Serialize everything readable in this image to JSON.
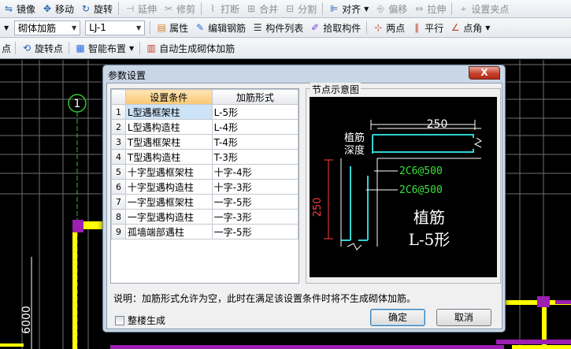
{
  "toolbar1": {
    "items": [
      {
        "icon": "mirror-icon",
        "label": "镜像",
        "enabled": true
      },
      {
        "icon": "move-icon",
        "label": "移动",
        "enabled": true
      },
      {
        "icon": "rotate-icon",
        "label": "旋转",
        "enabled": true
      },
      {
        "icon": "extend-icon",
        "label": "延伸",
        "enabled": false
      },
      {
        "icon": "trim-icon",
        "label": "修剪",
        "enabled": false
      },
      {
        "icon": "break-icon",
        "label": "打断",
        "enabled": false
      },
      {
        "icon": "merge-icon",
        "label": "合并",
        "enabled": false
      },
      {
        "icon": "split-icon",
        "label": "分割",
        "enabled": false
      },
      {
        "icon": "align-icon",
        "label": "对齐",
        "enabled": true
      },
      {
        "icon": "offset-icon",
        "label": "偏移",
        "enabled": false
      },
      {
        "icon": "stretch-icon",
        "label": "拉伸",
        "enabled": false
      },
      {
        "icon": "set-grip-icon",
        "label": "设置夹点",
        "enabled": false
      }
    ]
  },
  "toolbar2": {
    "type_combo": "砌体加筋",
    "name_combo": "LJ-1",
    "items": [
      {
        "icon": "properties-icon",
        "label": "属性"
      },
      {
        "icon": "edit-rebar-icon",
        "label": "编辑钢筋"
      },
      {
        "icon": "component-list-icon",
        "label": "构件列表"
      },
      {
        "icon": "pick-component-icon",
        "label": "拾取构件"
      },
      {
        "icon": "two-point-icon",
        "label": "两点"
      },
      {
        "icon": "parallel-icon",
        "label": "平行"
      },
      {
        "icon": "point-angle-icon",
        "label": "点角"
      }
    ]
  },
  "toolbar3": {
    "partial_label": "点",
    "items": [
      {
        "icon": "rotate-point-icon",
        "label": "旋转点"
      },
      {
        "icon": "smart-layout-icon",
        "label": "智能布置"
      },
      {
        "icon": "auto-generate-icon",
        "label": "自动生成砌体加筋"
      }
    ]
  },
  "cad": {
    "axis_label": "1",
    "dimension": "6000",
    "colors": {
      "background": "#000000",
      "wall": "#ffff00",
      "column": "#9b1fb0",
      "axis": "#2ec72e",
      "grid": "#8a8a8a"
    }
  },
  "dialog": {
    "title": "参数设置",
    "close_label": "X",
    "table": {
      "headers": [
        "设置条件",
        "加筋形式"
      ],
      "rows": [
        {
          "num": "1",
          "condition": "L型遇框架柱",
          "form": "L-5形"
        },
        {
          "num": "2",
          "condition": "L型遇构造柱",
          "form": "L-4形"
        },
        {
          "num": "3",
          "condition": "T型遇框架柱",
          "form": "T-4形"
        },
        {
          "num": "4",
          "condition": "T型遇构造柱",
          "form": "T-3形"
        },
        {
          "num": "5",
          "condition": "十字型遇框架柱",
          "form": "十字-4形"
        },
        {
          "num": "6",
          "condition": "十字型遇构造柱",
          "form": "十字-3形"
        },
        {
          "num": "7",
          "condition": "一字型遇框架柱",
          "form": "一字-5形"
        },
        {
          "num": "8",
          "condition": "一字型遇构造柱",
          "form": "一字-3形"
        },
        {
          "num": "9",
          "condition": "孤墙端部遇柱",
          "form": "一字-5形"
        }
      ]
    },
    "node_diagram": {
      "label": "节点示意图",
      "dim_horizontal": "250",
      "dim_vertical": "250",
      "anchor_label_1": "植筋",
      "anchor_label_2": "深度",
      "rebar_1": "2C6@500",
      "rebar_2": "2C6@500",
      "caption_1": "植筋",
      "caption_2": "L-5形",
      "colors": {
        "rebar": "#2fd3d3",
        "dimension": "#ffffff",
        "label_green": "#39e239",
        "hatch": "#ff3b3b"
      }
    },
    "note": "说明：加筋形式允许为空，此时在满足该设置条件时将不生成砌体加筋。",
    "checkbox_label": "整楼生成",
    "checkbox_checked": false,
    "ok_label": "确定",
    "cancel_label": "取消"
  }
}
